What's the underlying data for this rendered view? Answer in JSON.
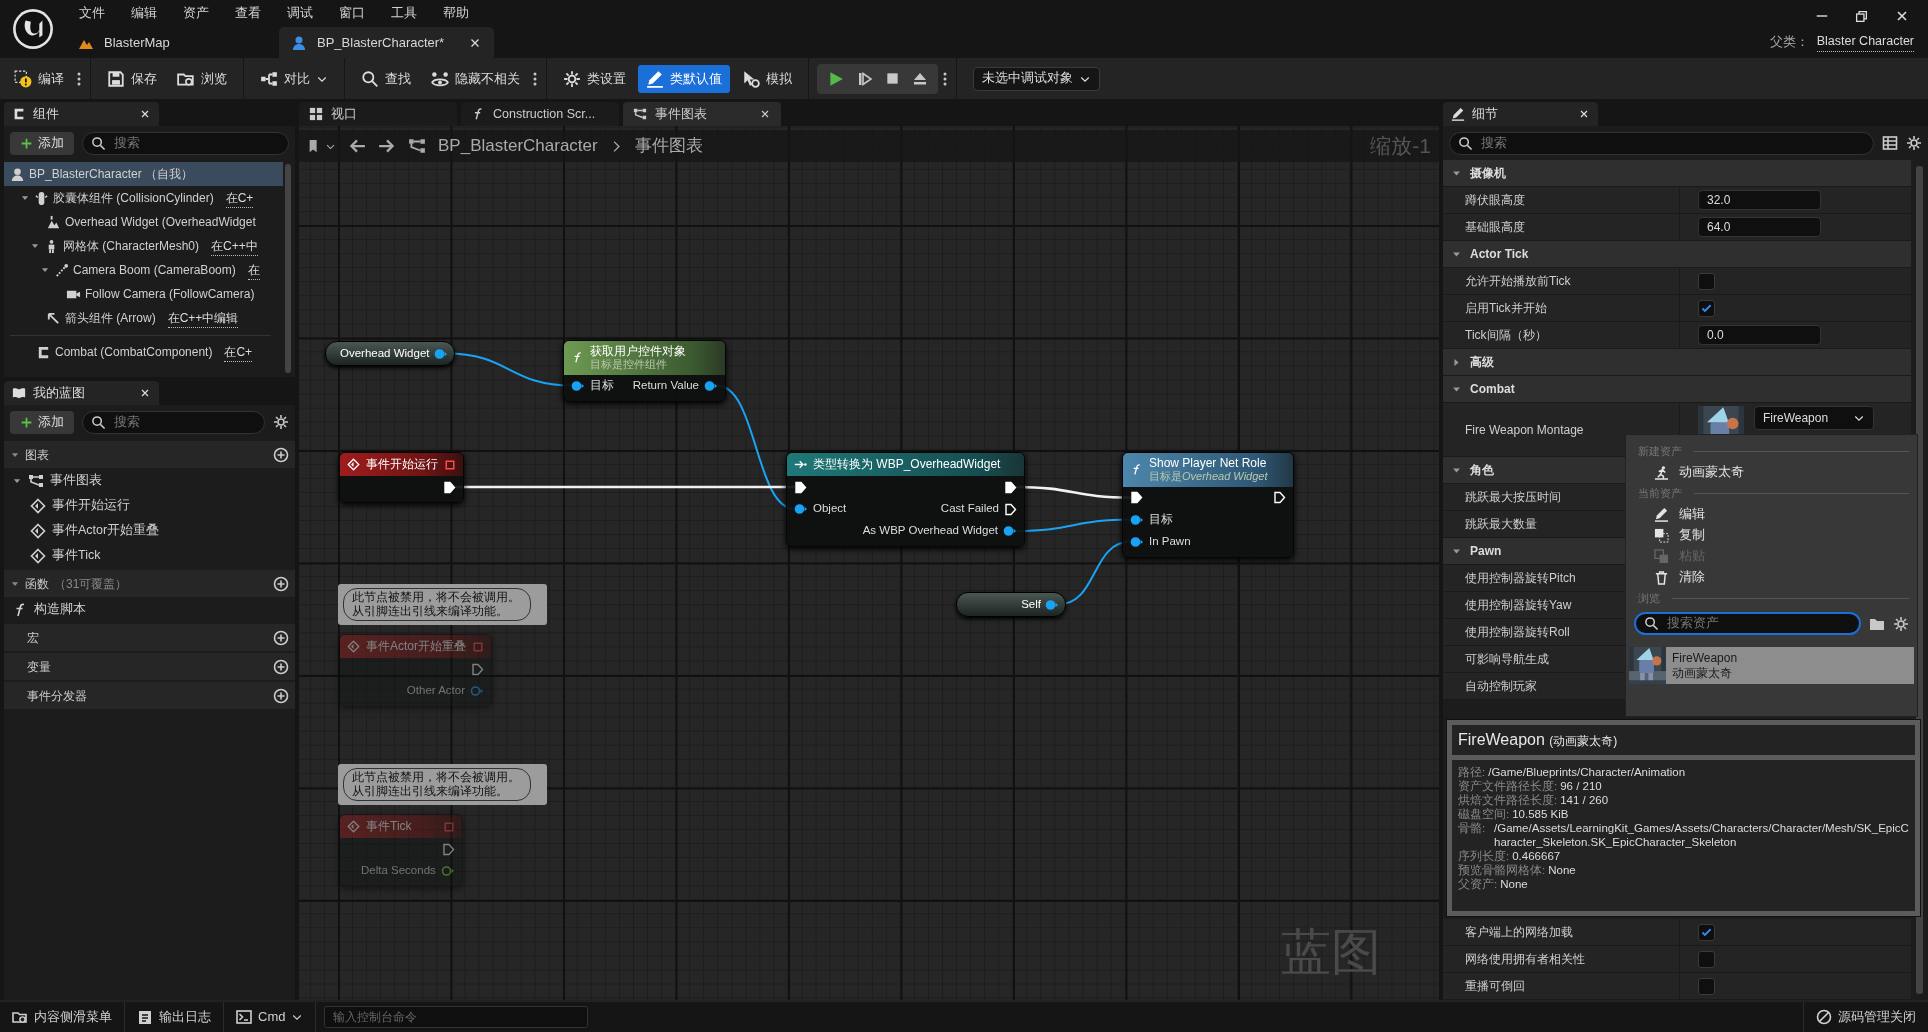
{
  "app_menu": [
    "文件",
    "编辑",
    "资产",
    "查看",
    "调试",
    "窗口",
    "工具",
    "帮助"
  ],
  "document_tabs": [
    {
      "label": "BlasterMap",
      "kind": "level",
      "selected": false
    },
    {
      "label": "BP_BlasterCharacter*",
      "kind": "blueprint",
      "selected": true
    }
  ],
  "parent_class": {
    "label": "父类：",
    "value": "Blaster Character"
  },
  "toolbar": [
    {
      "label": "编译",
      "more": true,
      "selected": false
    },
    {
      "label": "保存",
      "selected": false
    },
    {
      "label": "浏览",
      "selected": false
    },
    {
      "label": "对比",
      "dropdown": true,
      "selected": false
    },
    {
      "label": "查找",
      "selected": false
    },
    {
      "label": "隐藏不相关",
      "more": true,
      "selected": false
    },
    {
      "label": "类设置",
      "selected": false
    },
    {
      "label": "类默认值",
      "selected": true
    },
    {
      "label": "模拟",
      "selected": false
    }
  ],
  "debug_object": "未选中调试对象",
  "components": {
    "title": "组件",
    "add_label": "添加",
    "search_placeholder": "搜索",
    "tree": [
      {
        "label": "BP_BlasterCharacter （自我）",
        "kind": "actor",
        "selected": true,
        "children": [
          {
            "label": "胶囊体组件 (CollisionCylinder)",
            "link": "在C+",
            "kind": "capsule",
            "expanded": true,
            "selected": false,
            "children": [
              {
                "label": "Overhead Widget (OverheadWidget",
                "kind": "widget",
                "selected": false
              },
              {
                "label": "网格体 (CharacterMesh0)",
                "link": "在C++中",
                "kind": "mesh",
                "expanded": true,
                "selected": false,
                "children": [
                  {
                    "label": "Camera Boom (CameraBoom)",
                    "link": "在",
                    "kind": "spring_arm",
                    "expanded": true,
                    "selected": false,
                    "children": [
                      {
                        "label": "Follow Camera (FollowCamera)",
                        "kind": "camera",
                        "selected": false
                      }
                    ]
                  }
                ]
              },
              {
                "label": "箭头组件 (Arrow)",
                "link": "在C++中编辑",
                "kind": "arrow",
                "selected": false
              }
            ]
          }
        ]
      },
      {
        "label": "Combat (CombatComponent)",
        "link": "在C+",
        "kind": "component",
        "selected": false
      }
    ]
  },
  "my_blueprint": {
    "title": "我的蓝图",
    "add_label": "添加",
    "search_placeholder": "搜索",
    "sections": [
      {
        "label": "图表",
        "expanded": true,
        "items": [
          {
            "label": "事件图表",
            "kind": "graph",
            "expanded": true,
            "children": [
              {
                "label": "事件开始运行",
                "kind": "event"
              },
              {
                "label": "事件Actor开始重叠",
                "kind": "event"
              },
              {
                "label": "事件Tick",
                "kind": "event"
              }
            ]
          }
        ]
      },
      {
        "label": "函数",
        "note": "（31可覆盖）",
        "expanded": true,
        "items": [
          {
            "label": "构造脚本",
            "kind": "function"
          }
        ]
      },
      {
        "label": "宏"
      },
      {
        "label": "变量"
      },
      {
        "label": "事件分发器"
      }
    ]
  },
  "graph_tabs": [
    {
      "label": "视口",
      "kind": "viewport",
      "selected": false
    },
    {
      "label": "Construction Scr...",
      "kind": "function",
      "selected": false
    },
    {
      "label": "事件图表",
      "kind": "graph",
      "selected": true
    }
  ],
  "breadcrumb": [
    "BP_BlasterCharacter",
    "事件图表"
  ],
  "zoom_label": "缩放-1",
  "graph_label": "蓝图",
  "nodes": [
    {
      "kind": "variable",
      "title": "Overhead Widget",
      "disabled": false,
      "rows": [
        {
          "right": {
            "kind": "object",
            "connected": true
          }
        }
      ]
    },
    {
      "kind": "pure_function",
      "title": "获取用户控件对象",
      "subtitle": "目标是控件组件",
      "disabled": false,
      "rows": [
        {
          "left": {
            "label": "目标",
            "kind": "object",
            "connected": true
          },
          "right": {
            "label": "Return Value",
            "kind": "object",
            "connected": true
          }
        }
      ]
    },
    {
      "kind": "event",
      "title": "事件开始运行",
      "disabled": false,
      "rows": [
        {
          "right": {
            "kind": "exec",
            "connected": true
          }
        }
      ]
    },
    {
      "kind": "cast",
      "title": "类型转换为 WBP_OverheadWidget",
      "disabled": false,
      "rows": [
        {
          "left": {
            "kind": "exec",
            "connected": true
          },
          "right": {
            "kind": "exec",
            "connected": true
          }
        },
        {
          "left": {
            "label": "Object",
            "kind": "object",
            "connected": true
          },
          "right": {
            "label": "Cast Failed",
            "kind": "exec",
            "connected": false
          }
        },
        {
          "right": {
            "label": "As WBP Overhead Widget",
            "kind": "object",
            "connected": true
          }
        }
      ]
    },
    {
      "kind": "function",
      "title": "Show Player Net Role",
      "subtitle": "目标是",
      "subtitle_italic": "Overhead Widget",
      "disabled": false,
      "rows": [
        {
          "left": {
            "kind": "exec",
            "connected": true
          },
          "right": {
            "kind": "exec",
            "connected": false
          }
        },
        {
          "left": {
            "label": "目标",
            "kind": "object",
            "connected": true
          }
        },
        {
          "left": {
            "label": "In Pawn",
            "kind": "object",
            "connected": true
          }
        }
      ]
    },
    {
      "kind": "variable",
      "title": "Self",
      "disabled": false,
      "rows": [
        {
          "right": {
            "kind": "object",
            "connected": true
          }
        }
      ]
    },
    {
      "kind": "event",
      "title": "事件Actor开始重叠",
      "disabled": true,
      "comment": "此节点被禁用，将不会被调用。从引脚连出引线来编译功能。",
      "rows": [
        {
          "right": {
            "kind": "exec",
            "connected": false
          }
        },
        {
          "right": {
            "label": "Other Actor",
            "kind": "object",
            "connected": false
          }
        }
      ]
    },
    {
      "kind": "event",
      "title": "事件Tick",
      "disabled": true,
      "comment": "此节点被禁用，将不会被调用。从引脚连出引线来编译功能。",
      "rows": [
        {
          "right": {
            "kind": "exec",
            "connected": false
          }
        },
        {
          "right": {
            "label": "Delta Seconds",
            "kind": "float",
            "connected": false
          }
        }
      ]
    }
  ],
  "details": {
    "title": "细节",
    "search_placeholder": "搜索",
    "sections": [
      {
        "label": "摄像机",
        "expanded": true,
        "rows": [
          {
            "label": "蹲伏眼高度",
            "kind": "number",
            "value": "32.0"
          },
          {
            "label": "基础眼高度",
            "kind": "number",
            "value": "64.0"
          }
        ]
      },
      {
        "label": "Actor Tick",
        "expanded": true,
        "rows": [
          {
            "label": "允许开始播放前Tick",
            "kind": "checkbox",
            "checked": false
          },
          {
            "label": "启用Tick并开始",
            "kind": "checkbox",
            "checked": true
          },
          {
            "label": "Tick间隔（秒）",
            "kind": "number",
            "value": "0.0"
          }
        ]
      },
      {
        "label": "高级",
        "expanded": false
      },
      {
        "label": "Combat",
        "expanded": true,
        "rows": [
          {
            "label": "Fire Weapon Montage",
            "kind": "asset",
            "value": "FireWeapon"
          }
        ]
      },
      {
        "label": "角色",
        "expanded": true,
        "rows": [
          {
            "label": "跳跃最大按压时间",
            "kind": "label"
          },
          {
            "label": "跳跃最大数量",
            "kind": "label"
          }
        ]
      },
      {
        "label": "Pawn",
        "expanded": true,
        "rows": [
          {
            "label": "使用控制器旋转Pitch",
            "kind": "label"
          },
          {
            "label": "使用控制器旋转Yaw",
            "kind": "label"
          },
          {
            "label": "使用控制器旋转Roll",
            "kind": "label"
          },
          {
            "label": "可影响导航生成",
            "kind": "label"
          },
          {
            "label": "自动控制玩家",
            "kind": "label"
          }
        ]
      }
    ],
    "lower_rows": [
      {
        "label": "客户端上的网络加载",
        "kind": "checkbox",
        "checked": true
      },
      {
        "label": "网络使用拥有者相关性",
        "kind": "checkbox",
        "checked": false
      },
      {
        "label": "重播可倒回",
        "kind": "checkbox",
        "checked": false
      }
    ]
  },
  "asset_menu": {
    "sections": [
      {
        "header": "新建资产",
        "items": [
          {
            "label": "动画蒙太奇",
            "kind": "montage",
            "disabled": false
          }
        ]
      },
      {
        "header": "当前资产",
        "items": [
          {
            "label": "编辑",
            "kind": "edit",
            "disabled": false
          },
          {
            "label": "复制",
            "kind": "copy",
            "disabled": false
          },
          {
            "label": "粘贴",
            "kind": "paste",
            "disabled": true
          },
          {
            "label": "清除",
            "kind": "clear",
            "disabled": false
          }
        ]
      },
      {
        "header": "浏览"
      }
    ],
    "search_placeholder": "搜索资产",
    "results": [
      {
        "name": "FireWeapon",
        "type": "动画蒙太奇",
        "selected": true
      }
    ]
  },
  "tooltip": {
    "title": "FireWeapon",
    "title_type": "(动画蒙太奇)",
    "lines": [
      {
        "label": "路径:",
        "value": "/Game/Blueprints/Character/Animation"
      },
      {
        "label": "资产文件路径长度:",
        "value": "96 / 210"
      },
      {
        "label": "烘焙文件路径长度:",
        "value": "141 / 260"
      },
      {
        "label": "磁盘空间:",
        "value": "10.585 KiB"
      },
      {
        "label": "骨骼:",
        "value": "/Game/Assets/LearningKit_Games/Assets/Characters/Character/Mesh/SK_EpicCharacter_Skeleton.SK_EpicCharacter_Skeleton"
      },
      {
        "label": "序列长度:",
        "value": "0.466667"
      },
      {
        "label": "预览骨骼网格体:",
        "value": "None"
      },
      {
        "label": "父资产:",
        "value": "None"
      }
    ]
  },
  "status_bar": {
    "buttons": [
      {
        "label": "内容侧滑菜单",
        "kind": "drawer"
      },
      {
        "label": "输出日志",
        "kind": "log"
      },
      {
        "label": "Cmd",
        "kind": "cmd"
      }
    ],
    "console_placeholder": "输入控制台命令",
    "source_control": "源码管理关闭"
  }
}
